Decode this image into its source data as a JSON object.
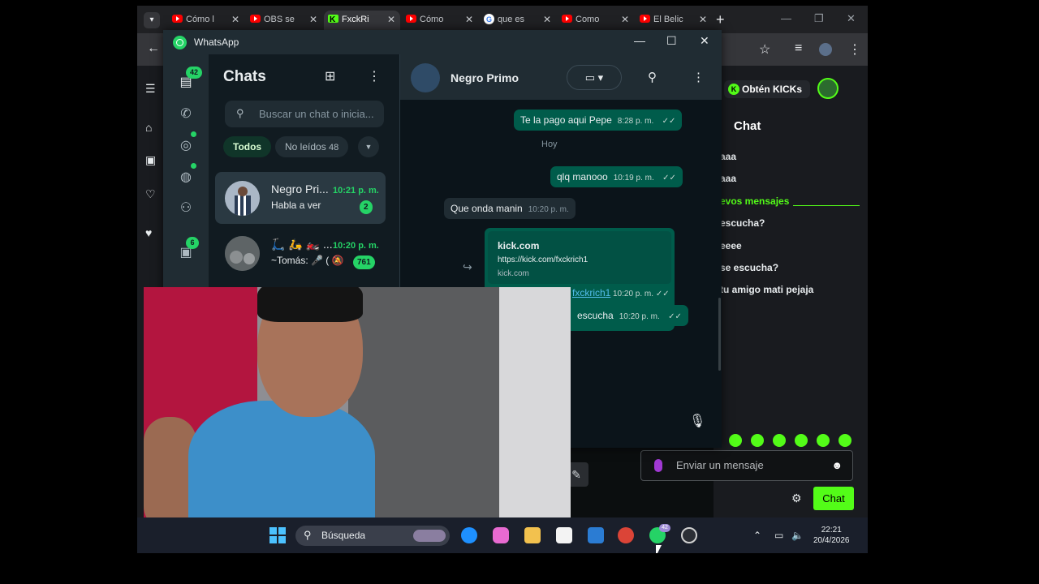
{
  "browser": {
    "tabs": [
      {
        "label": "Cómo l",
        "icon": "youtube-icon"
      },
      {
        "label": "OBS se",
        "icon": "youtube-icon"
      },
      {
        "label": "FxckRi",
        "icon": "kick-icon"
      },
      {
        "label": "Cómo",
        "icon": "youtube-icon"
      },
      {
        "label": "que es",
        "icon": "google-icon"
      },
      {
        "label": "Como",
        "icon": "youtube-icon"
      },
      {
        "label": "El Belic",
        "icon": "youtube-icon"
      }
    ]
  },
  "kick": {
    "get_kicks_label": "Obtén KICKs",
    "chat_title": "Chat",
    "messages": [
      "aaa",
      "aaa",
      "evos mensajes",
      "escucha?",
      "eeee",
      "se escucha?",
      "tu amigo mati pejaja"
    ],
    "send_placeholder": "Enviar un mensaje",
    "chat_button": "Chat",
    "accent": "#53fc18"
  },
  "whatsapp": {
    "window_title": "WhatsApp",
    "rail": {
      "chats_badge": "42",
      "archive_badge": "6"
    },
    "list": {
      "title": "Chats",
      "search_placeholder": "Buscar un chat o inicia...",
      "filters": {
        "all": "Todos",
        "unread": "No leídos",
        "unread_count": "48"
      },
      "chats": [
        {
          "name": "Negro Pri...",
          "time": "10:21 p. m.",
          "preview": "Habla a ver",
          "badge": "2"
        },
        {
          "name": "🛴 🛵 🏍️ ...",
          "time": "10:20 p. m.",
          "preview": "~Tomás: 🎤 ( 🔕",
          "badge": "761"
        }
      ]
    },
    "conversation": {
      "contact": "Negro Primo",
      "messages": [
        {
          "text": "Te la pago aqui Pepe",
          "time": "8:28 p. m."
        },
        {
          "day": "Hoy"
        },
        {
          "text": "qlq manooo",
          "time": "10:19 p. m."
        },
        {
          "text": "Que onda manin",
          "time": "10:20 p. m."
        },
        {
          "link_title": "kick.com",
          "link_url": "https://kick.com/fxckrich1",
          "link_domain": "kick.com",
          "link_text": "fxckrich1",
          "time": "10:20 p. m."
        },
        {
          "text": "escucha",
          "time": "10:20 p. m."
        }
      ]
    },
    "accent": "#25d366"
  },
  "taskbar": {
    "search_label": "Búsqueda",
    "whatsapp_badge": "42",
    "time": "22:21",
    "date": "20/4/2026"
  }
}
